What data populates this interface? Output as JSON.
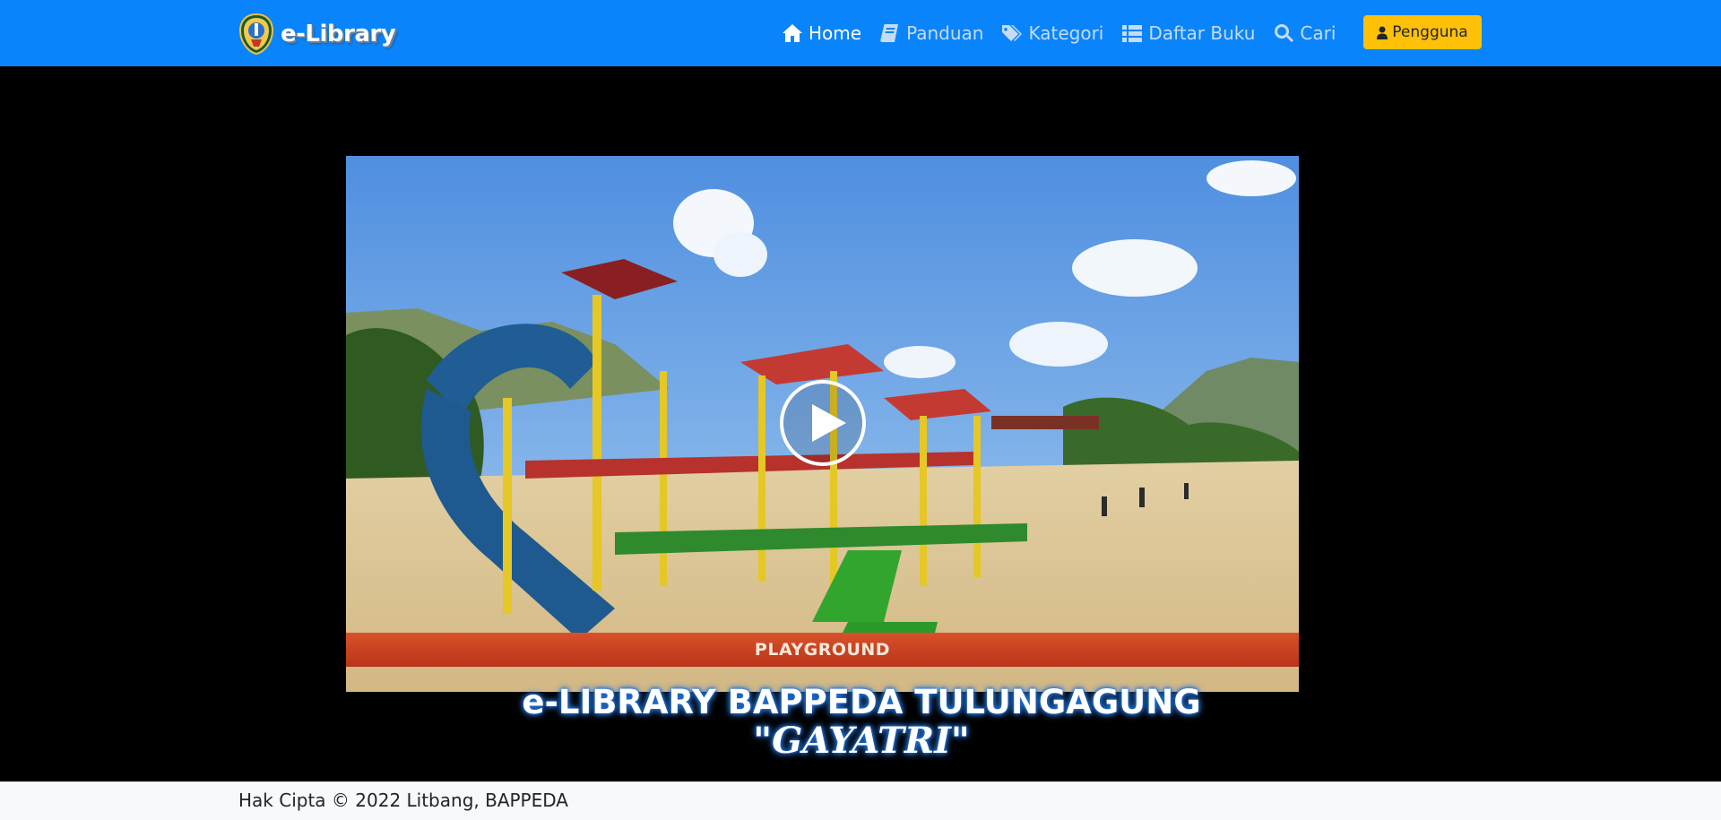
{
  "brand": {
    "title": "e-Library",
    "logo_icon": "emblem-icon"
  },
  "nav": {
    "items": [
      {
        "label": "Home",
        "icon": "home-icon",
        "active": true
      },
      {
        "label": "Panduan",
        "icon": "book-icon",
        "active": false
      },
      {
        "label": "Kategori",
        "icon": "tags-icon",
        "active": false
      },
      {
        "label": "Daftar Buku",
        "icon": "list-icon",
        "active": false
      },
      {
        "label": "Cari",
        "icon": "search-icon",
        "active": false
      }
    ],
    "user_button": {
      "label": "Pengguna",
      "icon": "user-icon"
    }
  },
  "video": {
    "banner_text": "PLAYGROUND",
    "play_icon": "play-icon"
  },
  "caption": {
    "title": "e-LIBRARY BAPPEDA TULUNGAGUNG",
    "subtitle": "\"GAYATRI\""
  },
  "footer": {
    "text": "Hak Cipta © 2022 Litbang, BAPPEDA"
  },
  "colors": {
    "navbar": "#0a84fa",
    "user_button": "#ffc107",
    "banner": "#c8421f",
    "footer": "#f8f9fa"
  }
}
